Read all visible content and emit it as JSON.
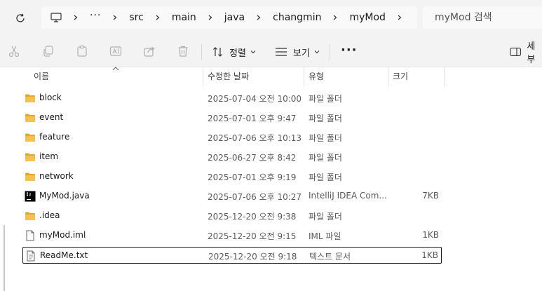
{
  "address_bar": {
    "crumbs": [
      "src",
      "main",
      "java",
      "changmin",
      "myMod"
    ],
    "search_placeholder": "myMod 검색"
  },
  "toolbar": {
    "sort_label": "정렬",
    "view_label": "보기",
    "details_label": "세부"
  },
  "columns": {
    "name": "이름",
    "modified": "수정한 날짜",
    "type": "유형",
    "size": "크기"
  },
  "rows": [
    {
      "name": "block",
      "date": "2025-07-04 오전 10:00",
      "type": "파일 폴더",
      "size": "",
      "icon": "folder-icon"
    },
    {
      "name": "event",
      "date": "2025-07-01 오후 9:47",
      "type": "파일 폴더",
      "size": "",
      "icon": "folder-icon"
    },
    {
      "name": "feature",
      "date": "2025-07-06 오후 10:13",
      "type": "파일 폴더",
      "size": "",
      "icon": "folder-icon"
    },
    {
      "name": "item",
      "date": "2025-06-27 오후 8:42",
      "type": "파일 폴더",
      "size": "",
      "icon": "folder-icon"
    },
    {
      "name": "network",
      "date": "2025-07-01 오후 9:19",
      "type": "파일 폴더",
      "size": "",
      "icon": "folder-icon"
    },
    {
      "name": "MyMod.java",
      "date": "2025-07-06 오후 10:27",
      "type": "IntelliJ IDEA Com...",
      "size": "7KB",
      "icon": "intellij-file-icon"
    },
    {
      "name": ".idea",
      "date": "2025-12-20 오전 9:38",
      "type": "파일 폴더",
      "size": "",
      "icon": "folder-icon"
    },
    {
      "name": "myMod.iml",
      "date": "2025-12-20 오전 9:15",
      "type": "IML 파일",
      "size": "1KB",
      "icon": "document-icon"
    },
    {
      "name": "ReadMe.txt",
      "date": "2025-12-20 오전 9:18",
      "type": "텍스트 문서",
      "size": "1KB",
      "icon": "text-file-icon"
    }
  ],
  "colors": {
    "folder": "#f2c14e",
    "folder_dark": "#e3a72f",
    "chrome_bg": "#f3f3f3"
  }
}
